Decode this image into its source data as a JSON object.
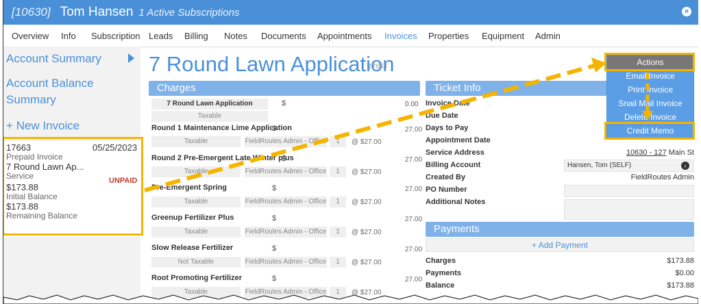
{
  "header": {
    "id": "[10630]",
    "name": "Tom Hansen",
    "subtitle": "1 Active Subscriptions",
    "close_icon": "×"
  },
  "tabs": [
    "Overview",
    "Info",
    "Subscription",
    "Leads",
    "Billing",
    "Notes",
    "Documents",
    "Appointments",
    "Invoices",
    "Properties",
    "Equipment",
    "Admin"
  ],
  "sidebar": {
    "account_summary": "Account Summary",
    "account_balance": "Account Balance Summary",
    "new_invoice": "+ New Invoice",
    "invoice_card": {
      "number": "17663",
      "date": "05/25/2023",
      "type": "Prepaid Invoice",
      "title": "7 Round Lawn Ap...",
      "category": "Service",
      "status": "UNPAID",
      "initial_amount": "$173.88",
      "initial_label": "Initial Balance",
      "remaining_amount": "$173.88",
      "remaining_label": "Remaining Balance"
    }
  },
  "main": {
    "title": "7 Round Lawn Application",
    "number": "17663"
  },
  "charges": {
    "header": "Charges",
    "top": {
      "name": "7 Round Lawn Application",
      "currency": "$",
      "amount": "0.00",
      "tax": "Taxable"
    },
    "items": [
      {
        "name": "Round 1 Maintenance Lime Application",
        "currency": "$",
        "amount": "27.00",
        "tax": "Taxable",
        "user": "FieldRoutes Admin - Office",
        "qty": "1",
        "rate": "@ $27.00"
      },
      {
        "name": "Round 2 Pre-Emergent Late Winter plus",
        "currency": "$",
        "amount": "27.00",
        "tax": "Taxable",
        "user": "FieldRoutes Admin - Office",
        "qty": "1",
        "rate": "@ $27.00"
      },
      {
        "name": "Pre-Emergent Spring",
        "currency": "$",
        "amount": "27.00",
        "tax": "Taxable",
        "user": "FieldRoutes Admin - Office",
        "qty": "1",
        "rate": "@ $27.00"
      },
      {
        "name": "Greenup Fertilizer Plus",
        "currency": "$",
        "amount": "27.00",
        "tax": "Taxable",
        "user": "FieldRoutes Admin - Office",
        "qty": "1",
        "rate": "@ $27.00"
      },
      {
        "name": "Slow Release Fertilizer",
        "currency": "$",
        "amount": "27.00",
        "tax": "Not Taxable",
        "user": "FieldRoutes Admin - Office",
        "qty": "1",
        "rate": "@ $27.00"
      },
      {
        "name": "Root Promoting Fertilizer",
        "currency": "$",
        "amount": "27.00",
        "tax": "Taxable",
        "user": "FieldRoutes Admin - Office",
        "qty": "1",
        "rate": "@ $27.00"
      }
    ]
  },
  "ticket": {
    "header": "Ticket Info",
    "invoice_date": "Invoice Date",
    "due_date": "Due Date",
    "days_to_pay": "Days to Pay",
    "appointment_date": "Appointment Date",
    "service_address_label": "Service Address",
    "service_address_link": "10630 - 127",
    "service_address_rest": " Main St",
    "billing_account_label": "Billing Account",
    "billing_account_value": "Hansen, Tom (SELF)",
    "created_by_label": "Created By",
    "created_by_value": "FieldRoutes Admin",
    "po_number_label": "PO Number",
    "notes_label": "Additional Notes"
  },
  "payments": {
    "header": "Payments",
    "add_label": "+ Add Payment",
    "rows": [
      {
        "label": "Charges",
        "value": "$173.88"
      },
      {
        "label": "Payments",
        "value": "$0.00"
      },
      {
        "label": "Balance",
        "value": "$173.88"
      }
    ]
  },
  "actions": {
    "head": "Actions",
    "items": [
      "Email Invoice",
      "Print Invoice",
      "Snail Mail Invoice",
      "Delete Invoice",
      "Credit Memo"
    ]
  },
  "colors": {
    "accent": "#4a90d9",
    "highlight": "#f5b400",
    "unpaid": "#c0392b"
  }
}
